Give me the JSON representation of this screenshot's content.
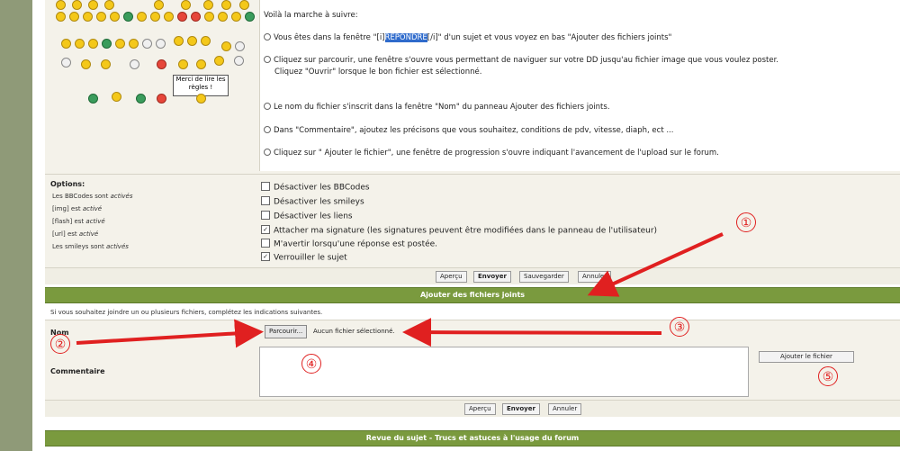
{
  "smileys": {
    "rules_sign": "Merci de lire les règles !"
  },
  "message": {
    "lines": [
      "Voilà la marche à suivre:",
      "Vous êtes dans la fenêtre \"[i]",
      "REPONDRE",
      "[/i]\" d'un sujet et vous voyez en bas \"Ajouter des fichiers joints\"",
      "Cliquez sur parcourir, une fenêtre s'ouvre vous permettant de naviguer sur votre DD jusqu'au fichier image que vous voulez poster.",
      "Cliquez \"Ouvrir\" lorsque le bon fichier est sélectionné.",
      "Le nom du fichier s'inscrit dans la fenêtre \"Nom\" du panneau Ajouter des fichiers joints.",
      "Dans \"Commentaire\", ajoutez les précisons que vous souhaitez, conditions de pdv, vitesse, diaph, ect ...",
      "Cliquez sur \" Ajouter le fichier\", une fenêtre de progression s'ouvre indiquant l'avancement de l'upload sur le forum."
    ]
  },
  "options": {
    "title": "Options:",
    "status": [
      {
        "label": "Les BBCodes sont",
        "value": "activés"
      },
      {
        "label": "[img] est",
        "value": "activé"
      },
      {
        "label": "[flash] est",
        "value": "activé"
      },
      {
        "label": "[url] est",
        "value": "activé"
      },
      {
        "label": "Les smileys sont",
        "value": "activés"
      }
    ],
    "checkboxes": [
      {
        "label": "Désactiver les BBCodes",
        "checked": false
      },
      {
        "label": "Désactiver les smileys",
        "checked": false
      },
      {
        "label": "Désactiver les liens",
        "checked": false
      },
      {
        "label": "Attacher ma signature (les signatures peuvent être modifiées dans le panneau de l'utilisateur)",
        "checked": true
      },
      {
        "label": "M'avertir lorsqu'une réponse est postée.",
        "checked": false
      },
      {
        "label": "Verrouiller le sujet",
        "checked": true
      }
    ]
  },
  "buttons": {
    "preview": "Aperçu",
    "submit": "Envoyer",
    "save": "Sauvegarder",
    "cancel": "Annuler"
  },
  "attachments": {
    "header": "Ajouter des fichiers joints",
    "hint": "Si vous souhaitez joindre un ou plusieurs fichiers, complétez les indications suivantes.",
    "name_label": "Nom",
    "browse": "Parcourir...",
    "no_file": "Aucun fichier sélectionné.",
    "comment_label": "Commentaire",
    "add_file": "Ajouter le fichier"
  },
  "review": {
    "header": "Revue du sujet - Trucs et astuces à l'usage du forum"
  },
  "annotations": {
    "n1": "①",
    "n2": "②",
    "n3": "③",
    "n4": "④",
    "n5": "⑤",
    "color": "#e02020"
  },
  "colors": {
    "green_bar": "#7a9a3e",
    "panel_bg": "#f4f2ea",
    "left_bar": "#8f9a78"
  }
}
